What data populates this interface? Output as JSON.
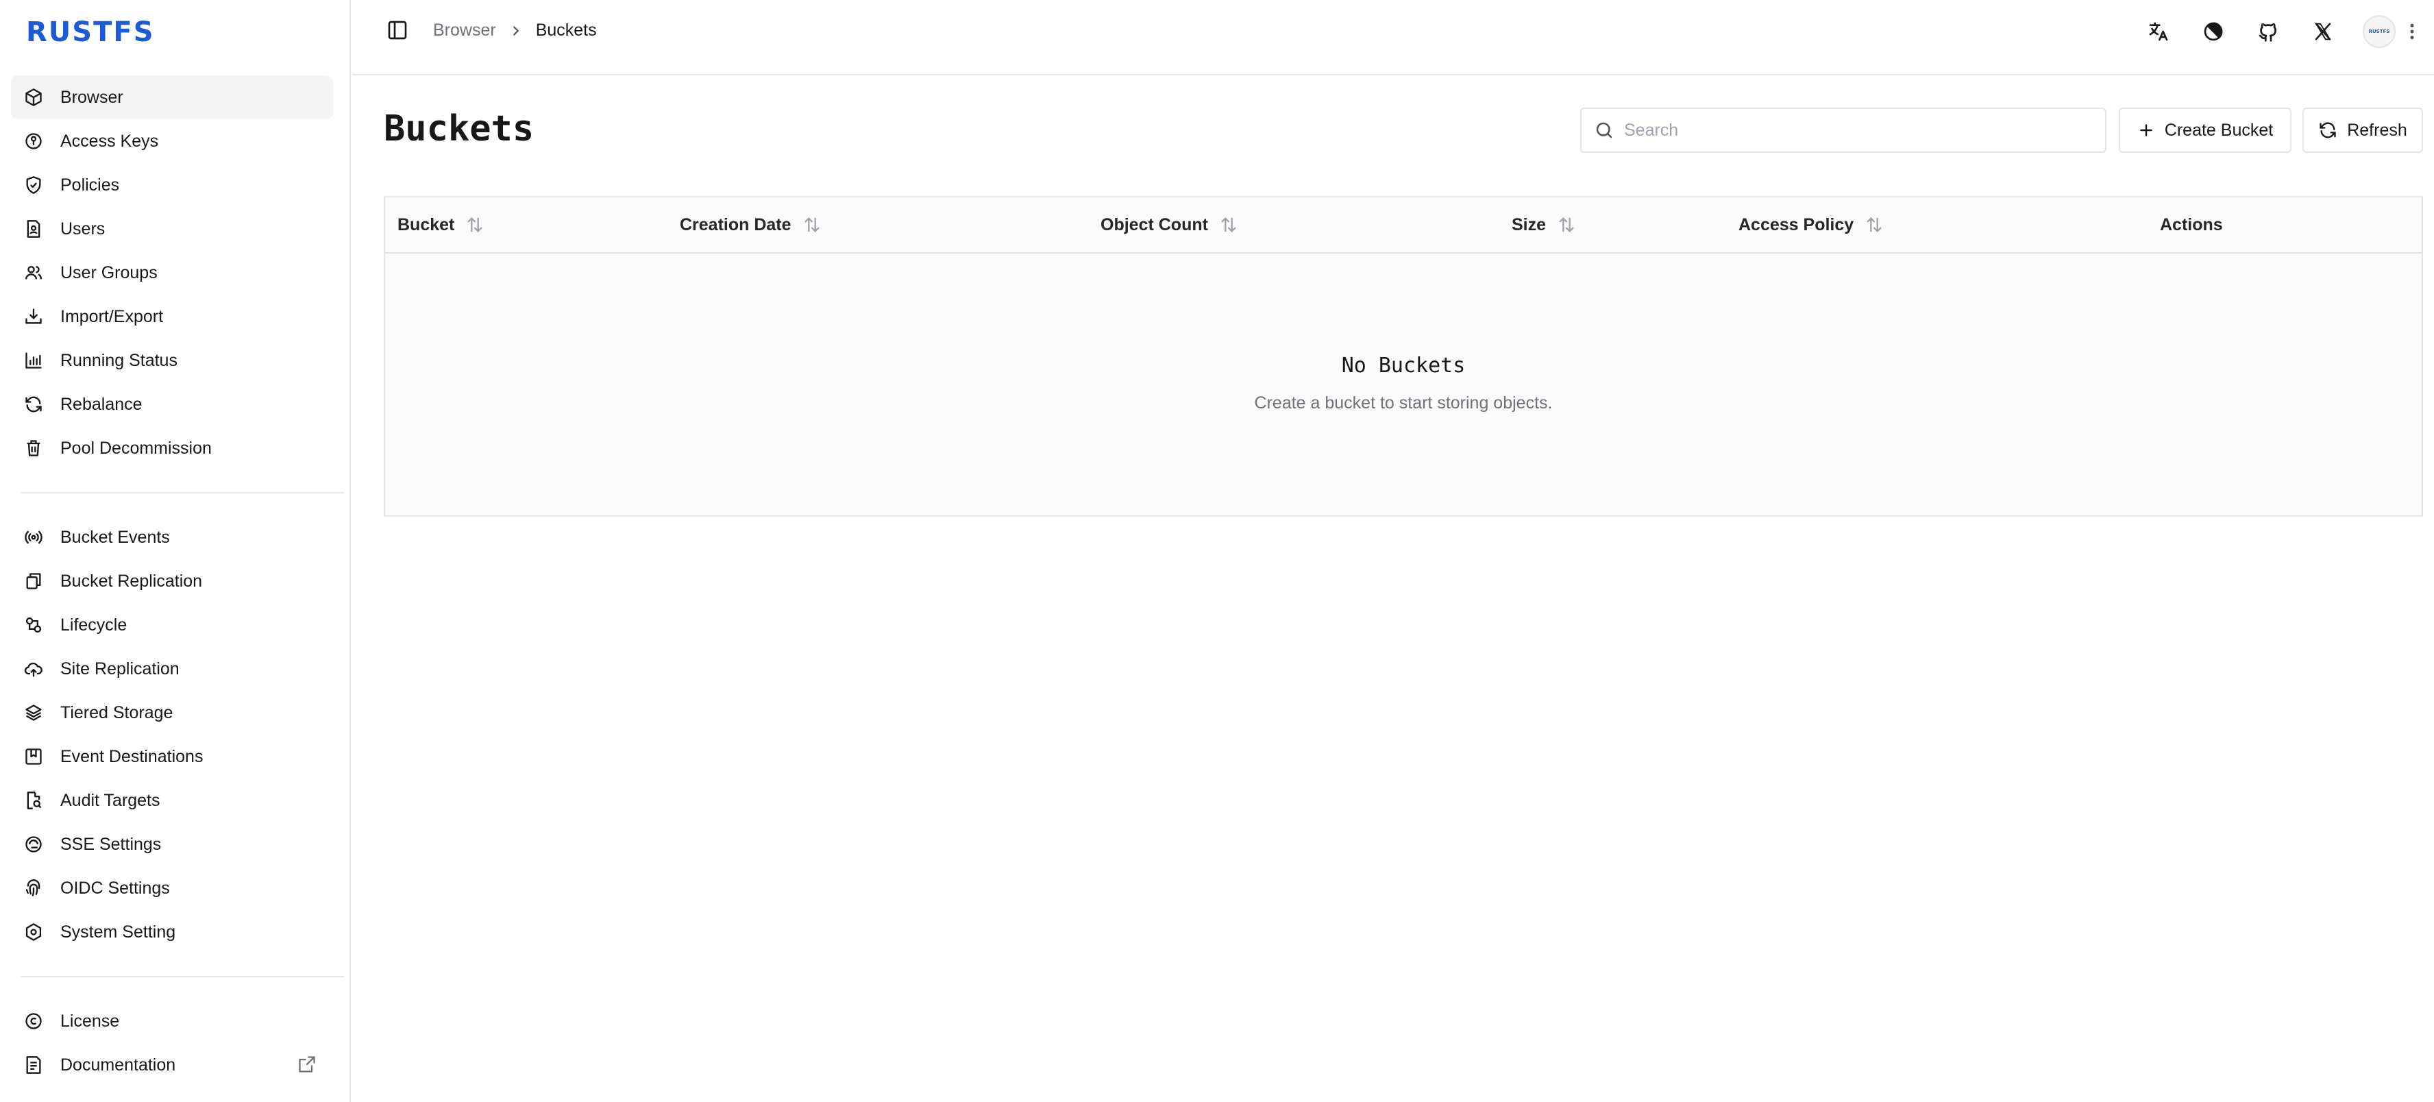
{
  "app": {
    "logo_text": "RUSTFS",
    "brand_color": "#1d5bd6"
  },
  "sidebar": {
    "primary": [
      {
        "label": "Browser",
        "icon": "cube-icon",
        "active": true
      },
      {
        "label": "Access Keys",
        "icon": "key-icon"
      },
      {
        "label": "Policies",
        "icon": "shield-check-icon"
      },
      {
        "label": "Users",
        "icon": "user-file-icon"
      },
      {
        "label": "User Groups",
        "icon": "users-icon"
      },
      {
        "label": "Import/Export",
        "icon": "download-tray-icon"
      },
      {
        "label": "Running Status",
        "icon": "bar-chart-icon"
      },
      {
        "label": "Rebalance",
        "icon": "refresh-cycle-icon"
      },
      {
        "label": "Pool Decommission",
        "icon": "trash-icon"
      }
    ],
    "secondary": [
      {
        "label": "Bucket Events",
        "icon": "broadcast-icon"
      },
      {
        "label": "Bucket Replication",
        "icon": "copy-icon"
      },
      {
        "label": "Lifecycle",
        "icon": "lifecycle-icon"
      },
      {
        "label": "Site Replication",
        "icon": "cloud-upload-icon"
      },
      {
        "label": "Tiered Storage",
        "icon": "layers-icon"
      },
      {
        "label": "Event Destinations",
        "icon": "bookmark-icon"
      },
      {
        "label": "Audit Targets",
        "icon": "file-audit-icon"
      },
      {
        "label": "SSE Settings",
        "icon": "encryption-icon"
      },
      {
        "label": "OIDC Settings",
        "icon": "fingerprint-icon"
      },
      {
        "label": "System Setting",
        "icon": "hex-settings-icon"
      }
    ],
    "footer": [
      {
        "label": "License",
        "icon": "copyright-icon"
      },
      {
        "label": "Documentation",
        "icon": "document-icon",
        "external": true
      }
    ]
  },
  "topbar": {
    "breadcrumb_root": "Browser",
    "breadcrumb_current": "Buckets",
    "avatar_text": "RUSTFS"
  },
  "main": {
    "title": "Buckets",
    "search_placeholder": "Search",
    "create_label": "Create Bucket",
    "refresh_label": "Refresh",
    "columns": [
      "Bucket",
      "Creation Date",
      "Object Count",
      "Size",
      "Access Policy",
      "Actions"
    ],
    "empty_title": "No Buckets",
    "empty_subtitle": "Create a bucket to start storing objects."
  }
}
